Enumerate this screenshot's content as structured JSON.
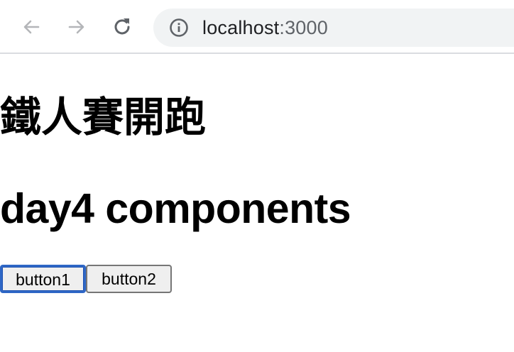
{
  "browser": {
    "address": {
      "host": "localhost",
      "port": ":3000"
    },
    "icons": {
      "back": "back-arrow-icon",
      "forward": "forward-arrow-icon",
      "reload": "reload-icon",
      "site_info": "info-icon"
    }
  },
  "page": {
    "heading_cjk": "鐵人賽開跑",
    "heading_day": "day4 components",
    "buttons": [
      {
        "label": "button1",
        "focused": true
      },
      {
        "label": "button2",
        "focused": false
      }
    ]
  },
  "colors": {
    "focus_ring": "#2f67c6",
    "button_bg": "#efefef",
    "omnibox_bg": "#f1f3f4"
  }
}
